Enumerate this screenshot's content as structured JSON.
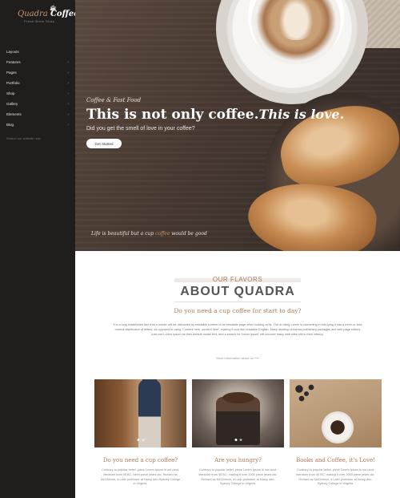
{
  "logo": {
    "brand_part1": "Quadra",
    "brand_part2": "Coffee",
    "tagline": "Fresh Brew Shop"
  },
  "sidebar": {
    "items": [
      {
        "label": "Layouts",
        "has_children": false
      },
      {
        "label": "Features",
        "has_children": true
      },
      {
        "label": "Pages",
        "has_children": true
      },
      {
        "label": "Portfolio",
        "has_children": true
      },
      {
        "label": "Shop",
        "has_children": true
      },
      {
        "label": "Gallery",
        "has_children": true
      },
      {
        "label": "Elements",
        "has_children": true
      },
      {
        "label": "Blog",
        "has_children": true
      }
    ],
    "search_placeholder": "Search our website now"
  },
  "hero": {
    "kicker": "Coffee & Fast Food",
    "title_main": "This is not only coffee.",
    "title_italic": "This is love.",
    "subtitle": "Did you get the smell of love in your coffee?",
    "cta_label": "Get Started",
    "quote_before": "Life is beautiful but a cup",
    "quote_highlight": "coffee",
    "quote_after": "would be good"
  },
  "about": {
    "kicker": "OUR FLAVORS",
    "title": "ABOUT QUADRA",
    "subtitle": "Do you need a cup coffee for start to day?",
    "body": "It is a long established fact that a reader will be distracted by readable content of an readable page when looking at its. The of using Lorem is converting in mid-lying it has a more-or-less normal distribution of letters, as opposed to using 'Content here, content here', making it look like readable English. Many desktop universal publishing packages and web page editors now use Lorem Ipsum as their default model text, and a search for 'lorem ipsum' will uncover many web sites still in their infancy.",
    "link_label": "More information about us ⟶"
  },
  "cards": [
    {
      "title": "Do you need a cup coffee?",
      "body": "Contrary to popular belief, piece Lorem Ipsum is not rand. literature from 45 BC, been piece years old. Richard as McClintock, a Latin professor at Hamp den-Sydney College in Virginia."
    },
    {
      "title": "Are you hungry?",
      "body": "Contrary to popular belief, piece Lorem Ipsum is not rand. literature from 45 BC, making it over 2000 piece years old. Richard as McClintock, a Latin professor at Hamp den-Sydney College in Virginia."
    },
    {
      "title": "Books and Coffee, it's Love!",
      "body": "Contrary to popular belief, piece Lorem Ipsum is not rand. literature from 45 BC, making it over 2000 piece years old. Richard as McClintock, a Latin professor at Hamp den-Sydney College in Virginia."
    }
  ],
  "colors": {
    "sidebar_bg": "#1f1e1d",
    "accent": "#b07a54",
    "hero_bg": "#4a3b33"
  }
}
